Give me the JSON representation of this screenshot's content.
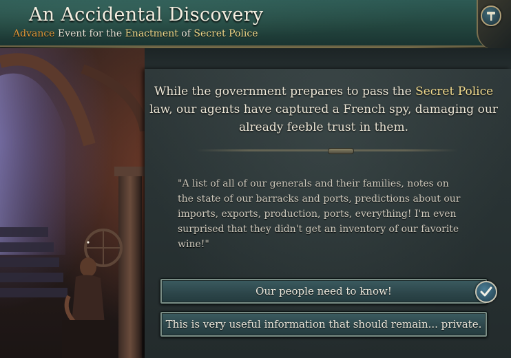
{
  "event": {
    "title": "An Accidental Discovery",
    "subtitle": {
      "part1": "Advance",
      "part2": " Event for the ",
      "part3": "Enactment",
      "part4": " of ",
      "part5": "Secret Police"
    }
  },
  "description": {
    "part1": "While the government prepares to pass the ",
    "highlight": "Secret Police",
    "part2": " law, our agents have captured a French spy, damaging our already feeble trust in them."
  },
  "flavor_text": "\"A list of all of our generals and their families, notes on the state of our barracks and ports, predictions about our imports, exports, production, ports, everything! I'm even surprised that they didn't get an inventory of our favorite wine!\"",
  "options": [
    {
      "label": "Our people need to know!"
    },
    {
      "label": "This is very useful information that should remain... private."
    }
  ],
  "icons": {
    "corner": "hammer-icon",
    "check": "checkmark-icon"
  },
  "colors": {
    "header_teal": "#2d5a54",
    "highlight_yellow": "#f3dc8f",
    "advance_orange": "#e39a3b",
    "option_teal": "#2c4549"
  }
}
